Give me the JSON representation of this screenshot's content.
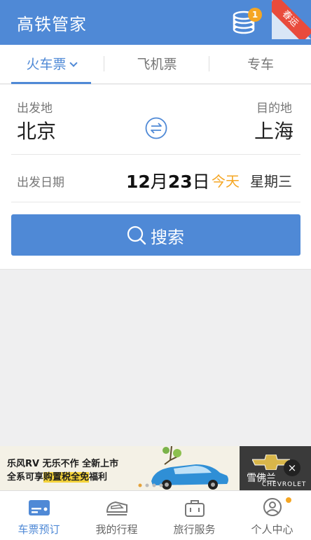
{
  "header": {
    "title": "高铁管家",
    "coin_badge": "1",
    "ribbon_text": "春运"
  },
  "tabs": [
    {
      "label": "火车票",
      "active": true
    },
    {
      "label": "飞机票",
      "active": false
    },
    {
      "label": "专车",
      "active": false
    }
  ],
  "route": {
    "from_label": "出发地",
    "from_city": "北京",
    "to_label": "目的地",
    "to_city": "上海",
    "swap_icon": "swap-arrows-icon"
  },
  "date": {
    "label": "出发日期",
    "month": "12",
    "month_unit": "月",
    "day": "23",
    "day_unit": "日",
    "relative": "今天",
    "weekday": "星期三"
  },
  "search": {
    "label": "搜索",
    "icon": "search-icon"
  },
  "ad": {
    "line1": "乐风RV 无乐不作 全新上市",
    "line2_pre": "全系可享",
    "line2_hl": "购置税全免",
    "line2_post": "福利",
    "brand_name": "雪佛兰",
    "brand_sub": "CHEVROLET",
    "close": "×"
  },
  "bottom_nav": [
    {
      "label": "车票预订",
      "icon": "ticket-icon",
      "active": true
    },
    {
      "label": "我的行程",
      "icon": "train-icon",
      "active": false
    },
    {
      "label": "旅行服务",
      "icon": "suitcase-icon",
      "active": false
    },
    {
      "label": "个人中心",
      "icon": "user-icon",
      "active": false
    }
  ],
  "colors": {
    "primary": "#4f89d6",
    "accent": "#f5a623",
    "ribbon": "#e94b3c"
  }
}
